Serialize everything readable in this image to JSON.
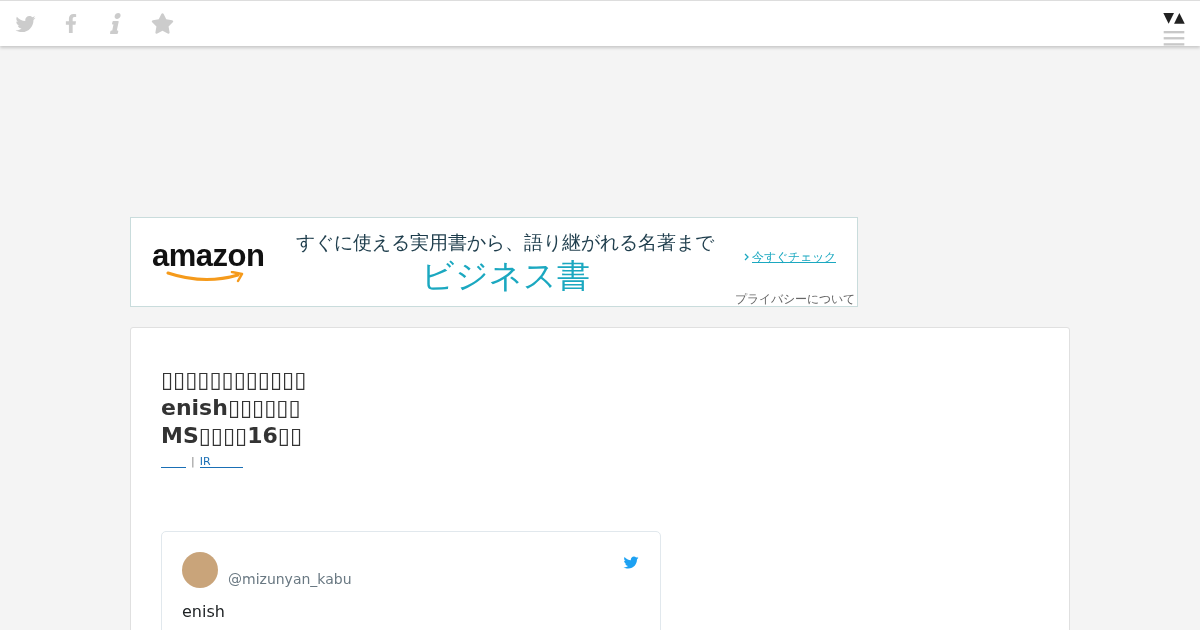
{
  "toolbar": {
    "toggle": "▼▲"
  },
  "ad": {
    "logo": "amazon",
    "tagline": "すぐに使える実用書から、語り継がれる名著まで",
    "headline": "ビジネス書",
    "cta": "今すぐチェック",
    "privacy": "プライバシーについて"
  },
  "article": {
    "title_lines": [
      "▯▯▯▯▯▯▯▯▯▯▯▯",
      "enish▯▯▯▯▯▯",
      "MS▯▯▯▯16▯▯"
    ],
    "links": [
      {
        "kind": "blank"
      },
      {
        "kind": "text",
        "label": "IR"
      }
    ],
    "separator": "|"
  },
  "tweet": {
    "handle": "@mizunyan_kabu",
    "text": "enish"
  }
}
